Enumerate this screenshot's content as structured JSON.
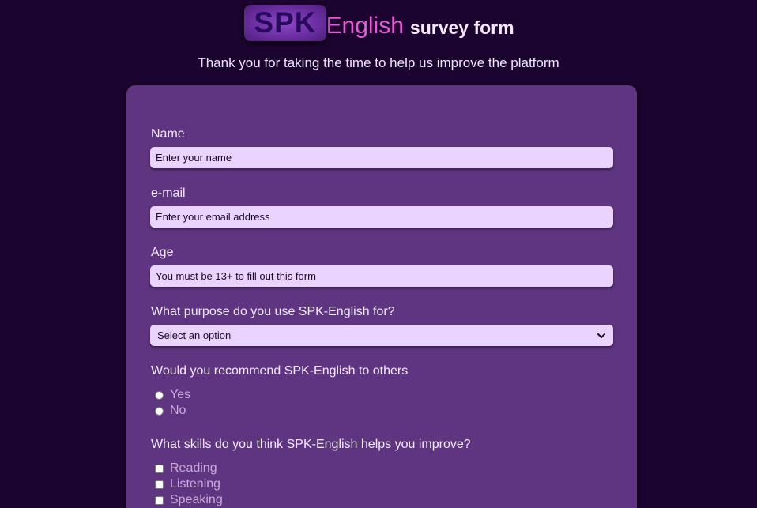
{
  "header": {
    "logo_spk": "SPK",
    "logo_english": "English",
    "title_suffix": "survey form",
    "subtitle": "Thank you for taking the time to help us improve the platform"
  },
  "form": {
    "name": {
      "label": "Name",
      "placeholder": "Enter your name",
      "value": ""
    },
    "email": {
      "label": "e-mail",
      "placeholder": "Enter your email address",
      "value": ""
    },
    "age": {
      "label": "Age",
      "placeholder": "You must be 13+ to fill out this form",
      "value": ""
    },
    "purpose": {
      "label": "What purpose do you use SPK-English for?",
      "selected": "Select an option"
    },
    "recommend": {
      "label": "Would you recommend SPK-English to others",
      "options": [
        "Yes",
        "No"
      ]
    },
    "skills": {
      "label": "What skills do you think SPK-English helps you improve?",
      "options": [
        "Reading",
        "Listening",
        "Speaking"
      ]
    }
  },
  "colors": {
    "background": "#1b0530",
    "card": "#5f3582",
    "input": "#ead4ff",
    "accent_pink": "#e85ad6",
    "logo_dark": "#2a0a5e"
  }
}
